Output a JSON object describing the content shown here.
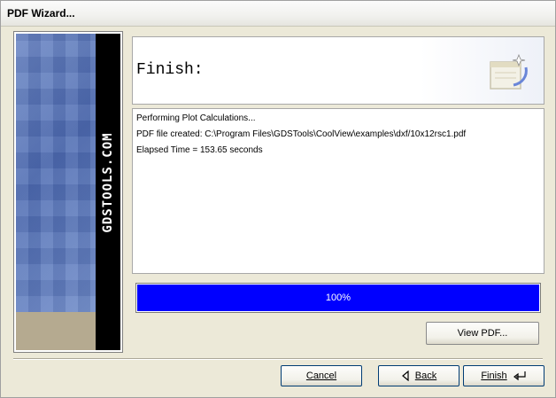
{
  "window": {
    "title": "PDF Wizard..."
  },
  "sidebar": {
    "brand": "GDSTOOLS.COM"
  },
  "header": {
    "title": "Finish:",
    "icon": "document-sparkle-icon"
  },
  "log": {
    "lines": [
      "Performing Plot Calculations...",
      "PDF file created: C:\\Program Files\\GDSTools\\CoolView\\examples\\dxf/10x12rsc1.pdf",
      "Elapsed Time = 153.65 seconds"
    ]
  },
  "progress": {
    "value": 1.0,
    "label": "100%",
    "color": "#0000ff"
  },
  "buttons": {
    "view_pdf": "View PDF...",
    "cancel": "Cancel",
    "back": "Back",
    "finish": "Finish"
  }
}
